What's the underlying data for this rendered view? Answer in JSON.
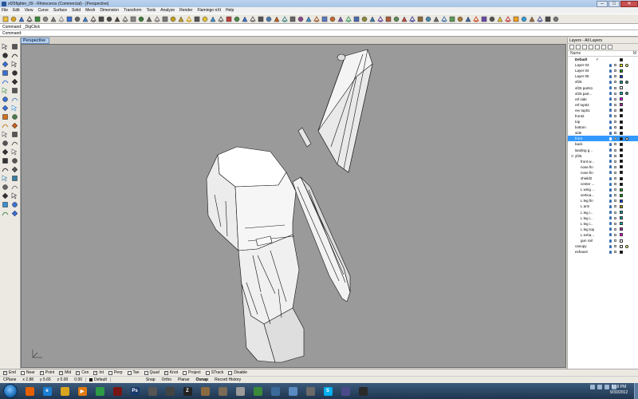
{
  "window": {
    "title": "xf25fighter_09 - Rhinoceros (Commercial) - [Perspective]"
  },
  "menu": [
    "File",
    "Edit",
    "View",
    "Curve",
    "Surface",
    "Solid",
    "Mesh",
    "Dimension",
    "Transform",
    "Tools",
    "Analyze",
    "Render",
    "Flamingo nXt",
    "Help"
  ],
  "command": {
    "history": "Command: _DigClick",
    "prompt": "Command:"
  },
  "viewport": {
    "tab_label": "Perspective"
  },
  "layers": {
    "title": "Layers - All Layers",
    "column_header": "Name",
    "column_header_m": "M",
    "rows": [
      {
        "name": "Default",
        "check": "✓",
        "color": "#000000",
        "bold": true,
        "indent": 0,
        "mat": null
      },
      {
        "name": "Layer 03",
        "color": "#ffff00",
        "indent": 0,
        "mat": "#ffff66"
      },
      {
        "name": "Layer 04",
        "color": "#00a000",
        "indent": 0,
        "mat": null
      },
      {
        "name": "Layer 05",
        "color": "#0040ff",
        "indent": 0,
        "mat": null
      },
      {
        "name": "xf25",
        "color": "#00a0a0",
        "indent": 0,
        "mat": "#2fa36b"
      },
      {
        "name": "xf25 parts1",
        "color": "#ffffff",
        "indent": 0,
        "mat": null
      },
      {
        "name": "xf25 part...",
        "color": "#00b0b0",
        "indent": 0,
        "mat": "#2fa36b"
      },
      {
        "name": "ref side",
        "color": "#ff00ff",
        "indent": 0,
        "mat": null
      },
      {
        "name": "ref top02",
        "color": "#b020b0",
        "indent": 0,
        "mat": null
      },
      {
        "name": "rev top01",
        "color": "#000000",
        "indent": 0,
        "mat": null
      },
      {
        "name": "front2",
        "color": "#000000",
        "indent": 0,
        "mat": null
      },
      {
        "name": "top",
        "color": "#000000",
        "indent": 0,
        "mat": null
      },
      {
        "name": "bottom",
        "color": "#000000",
        "indent": 0,
        "mat": null
      },
      {
        "name": "side",
        "color": "#000000",
        "indent": 0,
        "mat": null
      },
      {
        "name": "front",
        "color": "#000000",
        "indent": 0,
        "mat": "#ffffff",
        "current": true
      },
      {
        "name": "back",
        "color": "#000000",
        "indent": 0,
        "mat": null
      },
      {
        "name": "landing g...",
        "color": "#000000",
        "indent": 0,
        "mat": null
      },
      {
        "name": "yf25",
        "color": "#000000",
        "indent": 0,
        "mat": null,
        "group": true
      },
      {
        "name": "front w...",
        "color": "#000000",
        "indent": 1,
        "mat": null
      },
      {
        "name": "nose fin",
        "color": "#000000",
        "indent": 1,
        "mat": null
      },
      {
        "name": "nose fin",
        "color": "#000000",
        "indent": 1,
        "mat": null
      },
      {
        "name": "shield2",
        "color": "#000000",
        "indent": 1,
        "mat": null
      },
      {
        "name": "center ...",
        "color": "#000000",
        "indent": 1,
        "mat": null
      },
      {
        "name": "L wing ...",
        "color": "#00a000",
        "indent": 1,
        "mat": null
      },
      {
        "name": "vertica...",
        "color": "#00a000",
        "indent": 1,
        "mat": null
      },
      {
        "name": "L leg fin",
        "color": "#0040ff",
        "indent": 1,
        "mat": null
      },
      {
        "name": "L arm",
        "color": "#a0a000",
        "indent": 1,
        "mat": null
      },
      {
        "name": "L leg i...",
        "color": "#00a0a0",
        "indent": 1,
        "mat": null
      },
      {
        "name": "L leg i...",
        "color": "#00a0a0",
        "indent": 1,
        "mat": null
      },
      {
        "name": "L leg i...",
        "color": "#00b0b0",
        "indent": 1,
        "mat": null
      },
      {
        "name": "L leg top",
        "color": "#b020b0",
        "indent": 1,
        "mat": null
      },
      {
        "name": "L exha...",
        "color": "#ff00ff",
        "indent": 1,
        "mat": null
      },
      {
        "name": "gun rail",
        "color": "#ffffff",
        "indent": 1,
        "mat": null
      },
      {
        "name": "canopy",
        "color": "#ffffff",
        "indent": 0,
        "mat": "#ffff66"
      },
      {
        "name": "exhaust",
        "color": "#000000",
        "indent": 0,
        "mat": null
      }
    ]
  },
  "osnaps": [
    {
      "label": "End",
      "checked": true
    },
    {
      "label": "Near",
      "checked": false
    },
    {
      "label": "Point",
      "checked": true
    },
    {
      "label": "Mid",
      "checked": true
    },
    {
      "label": "Cen",
      "checked": true
    },
    {
      "label": "Int",
      "checked": true
    },
    {
      "label": "Perp",
      "checked": false
    },
    {
      "label": "Tan",
      "checked": false
    },
    {
      "label": "Quad",
      "checked": false
    },
    {
      "label": "Knot",
      "checked": true
    },
    {
      "label": "Project",
      "checked": false
    },
    {
      "label": "STrack",
      "checked": false
    },
    {
      "label": "Disable",
      "checked": false
    }
  ],
  "status": {
    "cplane": "CPlane",
    "x": "x 2.88",
    "y": "y 5.65",
    "z": "z 0.00",
    "dist": "0.00",
    "layer": "Default",
    "toggles": [
      {
        "label": "Snap",
        "on": false
      },
      {
        "label": "Ortho",
        "on": false
      },
      {
        "label": "Planar",
        "on": false
      },
      {
        "label": "Osnap",
        "on": true
      },
      {
        "label": "Record History",
        "on": false
      }
    ]
  },
  "taskbar": {
    "time": "5:16 PM",
    "date": "9/30/2012",
    "apps": [
      {
        "name": "firefox-icon",
        "color": "#e66000",
        "glyph": ""
      },
      {
        "name": "ie-icon",
        "color": "#1b7fd3",
        "glyph": "e"
      },
      {
        "name": "folder-icon",
        "color": "#d9a420",
        "glyph": ""
      },
      {
        "name": "media-player-icon",
        "color": "#e07a10",
        "glyph": "▶"
      },
      {
        "name": "chrome-icon",
        "color": "#2d9b46",
        "glyph": ""
      },
      {
        "name": "rhino-icon",
        "color": "#7a1515",
        "glyph": ""
      },
      {
        "name": "photoshop-icon",
        "color": "#1a3a6b",
        "glyph": "Ps"
      },
      {
        "name": "stamp-icon",
        "color": "#555555",
        "glyph": ""
      },
      {
        "name": "sketch-icon",
        "color": "#444444",
        "glyph": ""
      },
      {
        "name": "zbrush-icon",
        "color": "#222222",
        "glyph": "Z"
      },
      {
        "name": "dog-icon",
        "color": "#8a6a40",
        "glyph": ""
      },
      {
        "name": "gimp-icon",
        "color": "#7b6a55",
        "glyph": ""
      },
      {
        "name": "disc-icon",
        "color": "#9a9a9a",
        "glyph": ""
      },
      {
        "name": "paint-icon",
        "color": "#3a8a3a",
        "glyph": ""
      },
      {
        "name": "ball-icon",
        "color": "#3a6a9a",
        "glyph": ""
      },
      {
        "name": "notes-icon",
        "color": "#5a8ac0",
        "glyph": ""
      },
      {
        "name": "pen-icon",
        "color": "#6a6a6a",
        "glyph": ""
      },
      {
        "name": "skype-icon",
        "color": "#00aff0",
        "glyph": "S"
      },
      {
        "name": "eye-icon",
        "color": "#4a4a8a",
        "glyph": ""
      },
      {
        "name": "rhino-active-icon",
        "color": "#2a2a2a",
        "glyph": ""
      }
    ]
  }
}
